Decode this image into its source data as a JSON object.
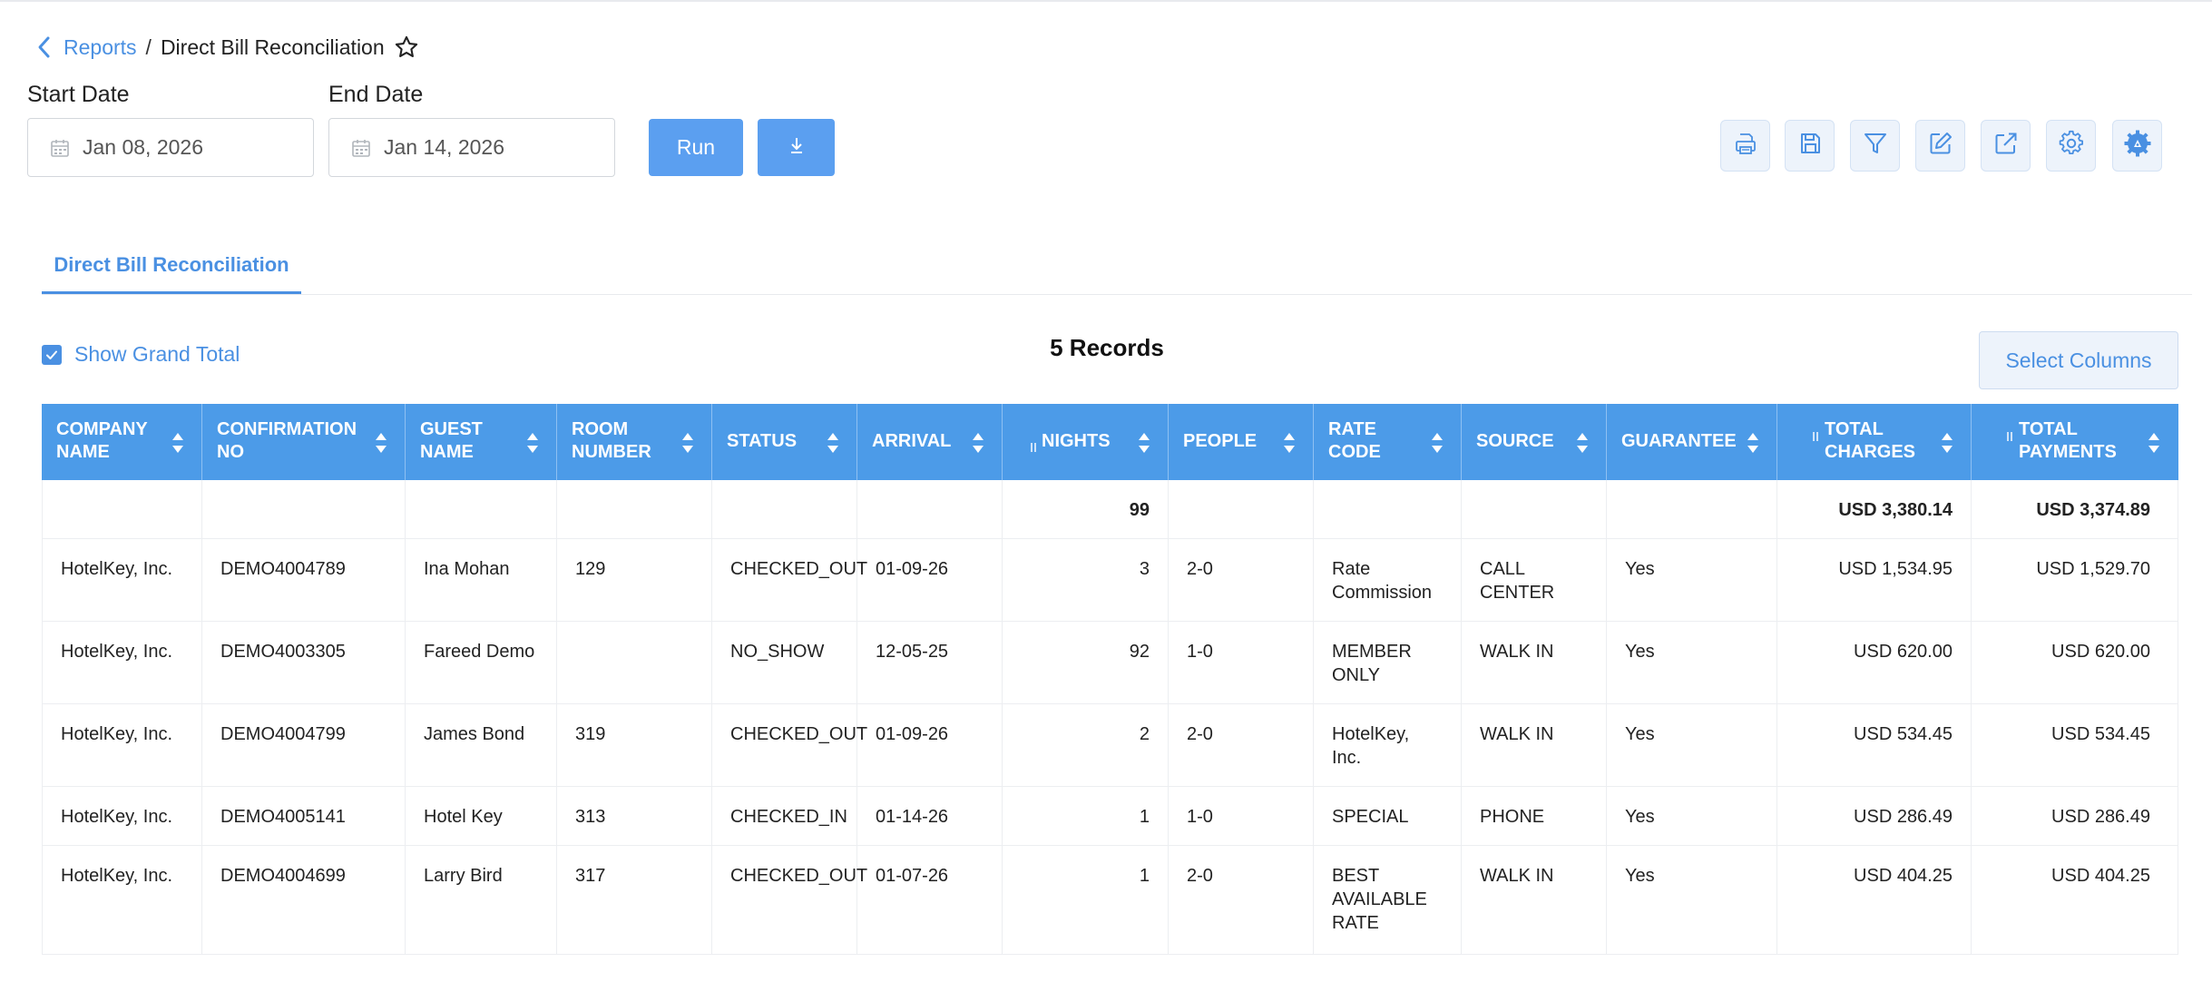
{
  "breadcrumb": {
    "parent": "Reports",
    "separator": "/",
    "current": "Direct Bill Reconciliation"
  },
  "filters": {
    "start_date": {
      "label": "Start Date",
      "value": "Jan 08, 2026"
    },
    "end_date": {
      "label": "End Date",
      "value": "Jan 14, 2026"
    }
  },
  "actions": {
    "run_label": "Run",
    "download_icon": "download-icon"
  },
  "toolbar": [
    "print-icon",
    "save-icon",
    "filter-icon",
    "edit-icon",
    "external-link-icon",
    "settings-icon",
    "settings-advanced-icon"
  ],
  "tabs": [
    {
      "label": "Direct Bill Reconciliation",
      "active": true
    }
  ],
  "grand_total": {
    "label": "Show Grand Total",
    "checked": true
  },
  "records_label": "5 Records",
  "select_columns_label": "Select Columns",
  "colors": {
    "accent": "#4a90e2",
    "header_bg": "#4c9be8",
    "button_bg": "#5b9ff0"
  },
  "table": {
    "columns": [
      {
        "label": "COMPANY NAME"
      },
      {
        "label": "CONFIRMATION NO"
      },
      {
        "label": "GUEST NAME"
      },
      {
        "label": "ROOM NUMBER"
      },
      {
        "label": "STATUS"
      },
      {
        "label": "ARRIVAL"
      },
      {
        "label": "NIGHTS"
      },
      {
        "label": "PEOPLE"
      },
      {
        "label": "RATE CODE"
      },
      {
        "label": "SOURCE"
      },
      {
        "label": "GUARANTEE"
      },
      {
        "label": "TOTAL CHARGES"
      },
      {
        "label": "TOTAL PAYMENTS"
      }
    ],
    "totals": [
      "",
      "",
      "",
      "",
      "",
      "",
      "99",
      "",
      "",
      "",
      "",
      "USD 3,380.14",
      "USD 3,374.89"
    ],
    "rows": [
      [
        "HotelKey, Inc.",
        "DEMO4004789",
        "Ina Mohan",
        "129",
        "CHECKED_OUT",
        "01-09-26",
        "3",
        "2-0",
        "Rate Commission",
        "CALL CENTER",
        "Yes",
        "USD 1,534.95",
        "USD 1,529.70"
      ],
      [
        "HotelKey, Inc.",
        "DEMO4003305",
        "Fareed Demo",
        "",
        "NO_SHOW",
        "12-05-25",
        "92",
        "1-0",
        "MEMBER ONLY",
        "WALK IN",
        "Yes",
        "USD 620.00",
        "USD 620.00"
      ],
      [
        "HotelKey, Inc.",
        "DEMO4004799",
        "James Bond",
        "319",
        "CHECKED_OUT",
        "01-09-26",
        "2",
        "2-0",
        "HotelKey, Inc.",
        "WALK IN",
        "Yes",
        "USD 534.45",
        "USD 534.45"
      ],
      [
        "HotelKey, Inc.",
        "DEMO4005141",
        "Hotel Key",
        "313",
        "CHECKED_IN",
        "01-14-26",
        "1",
        "1-0",
        "SPECIAL",
        "PHONE",
        "Yes",
        "USD 286.49",
        "USD 286.49"
      ],
      [
        "HotelKey, Inc.",
        "DEMO4004699",
        "Larry Bird",
        "317",
        "CHECKED_OUT",
        "01-07-26",
        "1",
        "2-0",
        "BEST AVAILABLE RATE",
        "WALK IN",
        "Yes",
        "USD 404.25",
        "USD 404.25"
      ]
    ]
  }
}
